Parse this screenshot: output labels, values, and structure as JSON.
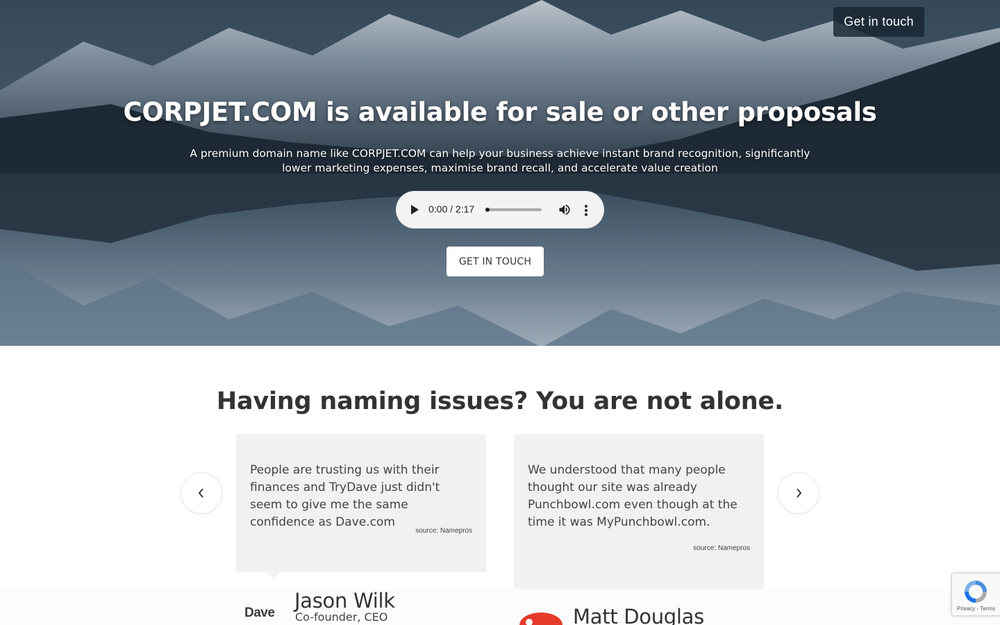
{
  "header": {
    "cta_label": "Get in touch"
  },
  "hero": {
    "title": "CORPJET.COM is available for sale or other proposals",
    "subtitle": "A premium domain name like CORPJET.COM can help your business achieve instant brand recognition, significantly lower marketing expenses, maximise brand recall, and accelerate value creation",
    "audio": {
      "time": "0:00 / 2:17",
      "progress": 0.0
    },
    "cta_label": "GET IN TOUCH"
  },
  "testimonials": {
    "title": "Having naming issues? You are not alone.",
    "items": [
      {
        "quote": "People are trusting us with their finances and TryDave just didn't seem to give me the same confidence as Dave.com",
        "source": "source: Namepros",
        "name": "Jason Wilk",
        "role": "Co-founder, CEO",
        "logo": "Dave"
      },
      {
        "quote": "We understood that many people thought our site was already Punchbowl.com even though at the time it was MyPunchbowl.com.",
        "source": "source: Namepros",
        "name": "Matt Douglas",
        "role": "",
        "logo": "punchbowl-logo-icon"
      }
    ]
  },
  "recaptcha": {
    "links": "Privacy - Terms"
  },
  "colors": {
    "hero_overlay": "#192632",
    "card_bg": "#f1f1f1",
    "text": "#333333"
  }
}
